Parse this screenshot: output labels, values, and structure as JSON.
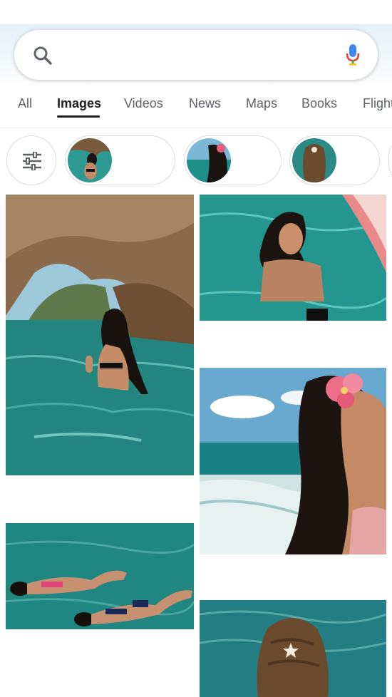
{
  "search": {
    "query": "",
    "icons": {
      "left": "search-icon",
      "right": "microphone-icon"
    }
  },
  "tabs": [
    {
      "label": "All"
    },
    {
      "label": "Images",
      "active": true
    },
    {
      "label": "Videos"
    },
    {
      "label": "News"
    },
    {
      "label": "Maps"
    },
    {
      "label": "Books"
    },
    {
      "label": "Flights"
    }
  ],
  "chips": {
    "filter_icon": "tune-sliders-icon",
    "suggestions": [
      {
        "icon": "woman-in-water-thumbnail"
      },
      {
        "icon": "woman-with-flower-thumbnail"
      },
      {
        "icon": "curly-hair-thumbnail"
      }
    ]
  },
  "results": [
    {
      "icon": "woman-in-sea-cave-image"
    },
    {
      "icon": "woman-swimming-pool-image"
    },
    {
      "icon": "woman-flower-beach-image"
    },
    {
      "icon": "women-floating-image"
    },
    {
      "icon": "curly-hair-sea-image"
    }
  ],
  "colors": {
    "accent": "#202124",
    "muted_text": "#5f6368",
    "chip_border": "#dadce0",
    "mic_blue": "#4285f4",
    "mic_red": "#ea4335",
    "sea": "#1f8f8a"
  }
}
